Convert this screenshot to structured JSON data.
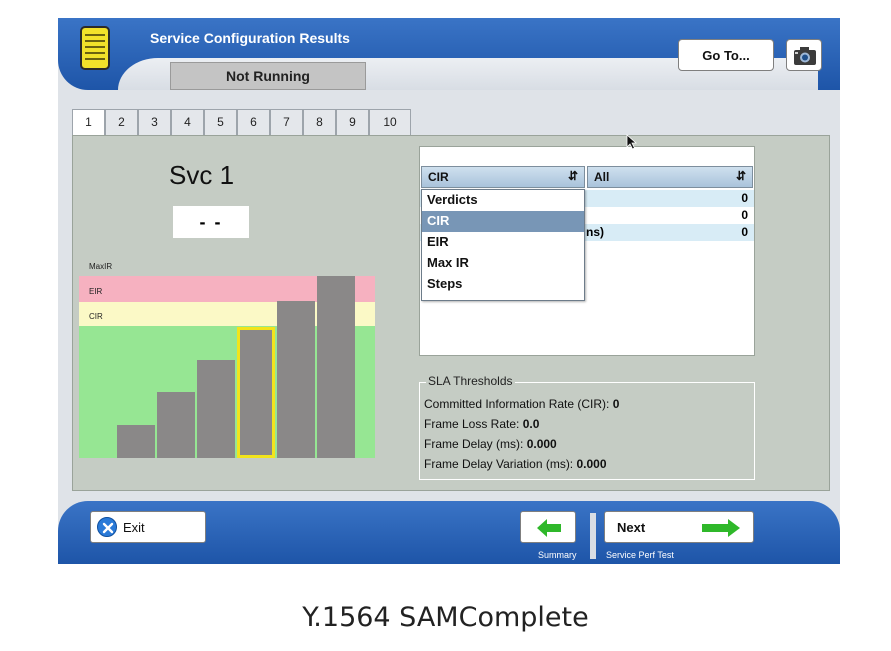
{
  "header": {
    "title": "Service Configuration Results",
    "status": "Not Running",
    "goto_label": "Go To..."
  },
  "tabs": [
    "1",
    "2",
    "3",
    "4",
    "5",
    "6",
    "7",
    "8",
    "9",
    "10"
  ],
  "active_tab": "1",
  "service": {
    "title": "Svc 1",
    "verdict": "- -"
  },
  "chart_levels": {
    "maxir": "MaxIR",
    "eir": "EIR",
    "cir": "CIR"
  },
  "chart_data": {
    "type": "bar",
    "bars": [
      0.18,
      0.36,
      0.54,
      0.72,
      0.86,
      1.0
    ],
    "selected_index": 3
  },
  "metric_combo": {
    "value": "CIR",
    "options": [
      "Verdicts",
      "CIR",
      "EIR",
      "Max IR",
      "Steps"
    ],
    "selected": "CIR"
  },
  "filter_combo": {
    "value": "All"
  },
  "results": {
    "rows": [
      {
        "label": "",
        "value": "0"
      },
      {
        "label": "",
        "value": "0"
      },
      {
        "label": "",
        "value": "0"
      },
      {
        "label": "ns)",
        "value": "0"
      }
    ]
  },
  "sla": {
    "title": "SLA Thresholds",
    "rows": [
      {
        "label": "Committed Information Rate (CIR):",
        "value": "0"
      },
      {
        "label": "Frame Loss Rate:",
        "value": "0.0"
      },
      {
        "label": "Frame Delay (ms):",
        "value": "0.000"
      },
      {
        "label": "Frame Delay Variation (ms):",
        "value": "0.000"
      }
    ]
  },
  "footer": {
    "exit_label": "Exit",
    "back_caption": "Summary",
    "next_label": "Next",
    "next_caption": "Service Perf Test"
  },
  "caption": "Y.1564 SAMComplete",
  "colors": {
    "header_blue": "#2b63b6",
    "eir_band": "#f6b1c0",
    "cir_band": "#fbf9c6",
    "pass_band": "#96e693",
    "bar": "#8a8888",
    "bar_selected_outline": "#f2e41c",
    "arrow_green": "#2fb82a"
  }
}
